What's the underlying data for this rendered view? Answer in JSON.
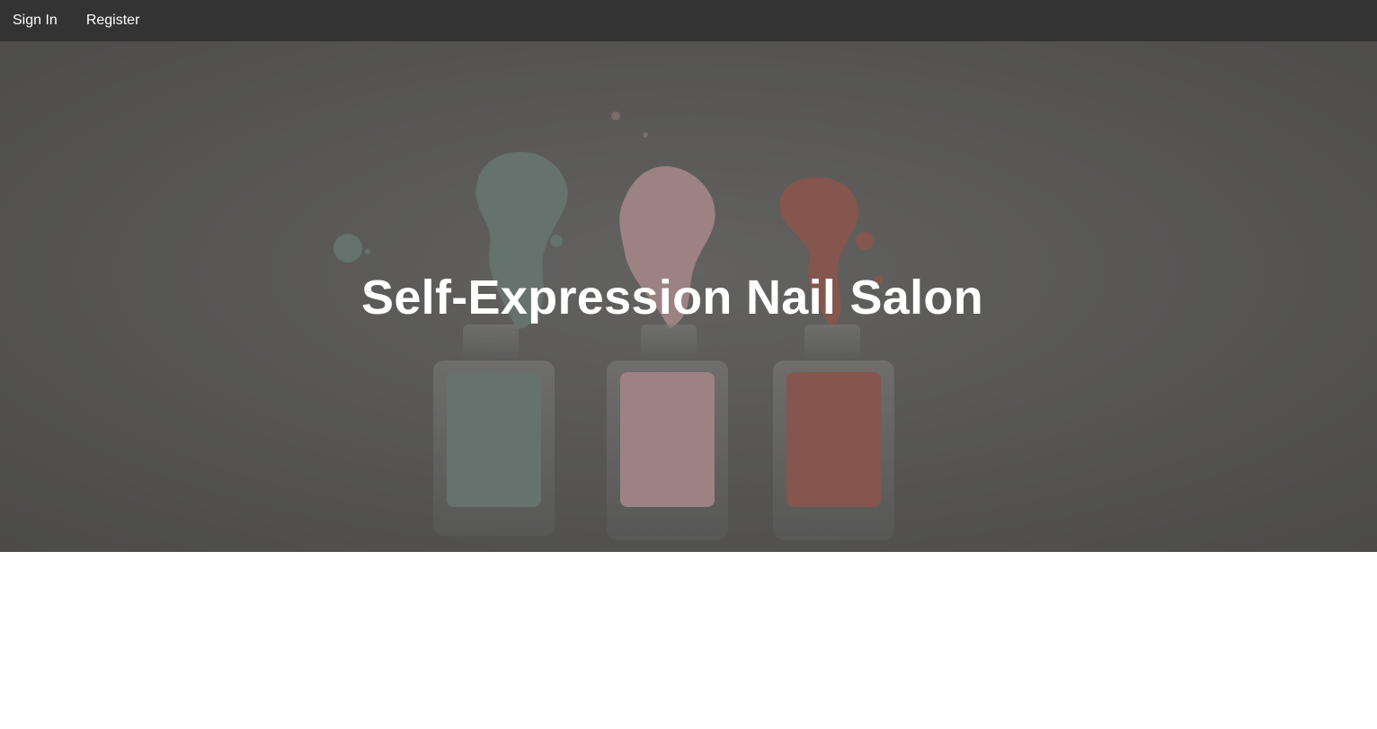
{
  "nav": {
    "items": [
      {
        "label": "Sign In"
      },
      {
        "label": "Register"
      }
    ],
    "background": "#333333"
  },
  "hero": {
    "title": "Self-Expression Nail Salon",
    "image_subject": "three nail polish bottles with spilled polish",
    "polish_colors": [
      "#7d8f8a",
      "#c9a6a6",
      "#a8685e"
    ]
  }
}
